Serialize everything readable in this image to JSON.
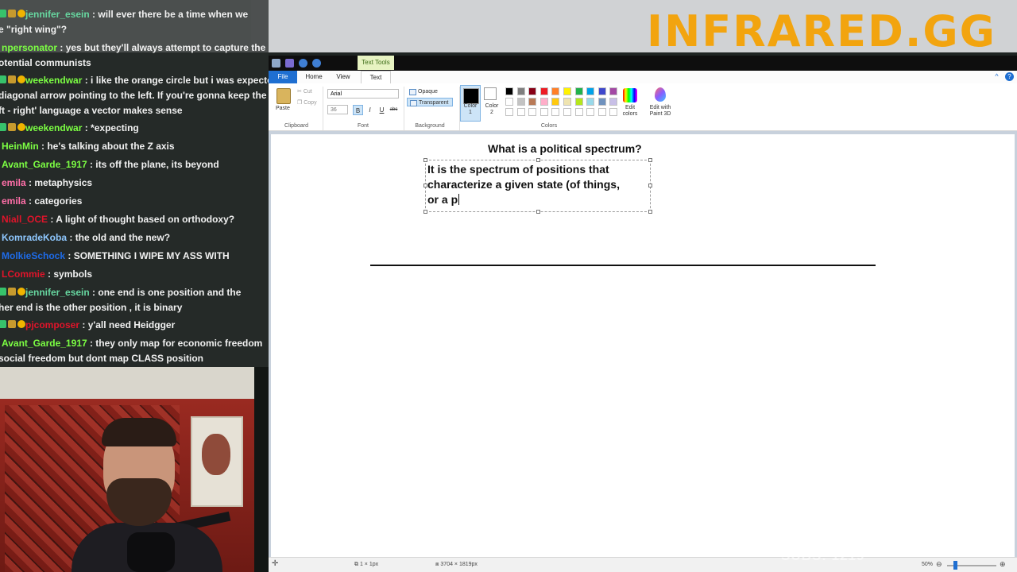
{
  "brand": {
    "logo": "INFRARED.GG"
  },
  "chat": {
    "messages": [
      {
        "user": "jennifer_esein",
        "text": ": will ever there be a time when we",
        "color": "#67d7a0",
        "badges": true
      },
      {
        "user": "",
        "text": "e \"right wing\"?",
        "color": "#f1f1f1",
        "badges": false
      },
      {
        "user": "npersonator",
        "text": ": yes but they'll always attempt to capture the",
        "color": "#7cff43",
        "badges": false
      },
      {
        "user": "",
        "text": "otential communists",
        "color": "#f1f1f1",
        "badges": false
      },
      {
        "user": "weekendwar",
        "text": ": i like the orange circle but i was expected",
        "color": "#7cff43",
        "badges": true
      },
      {
        "user": "",
        "text": "diagonal arrow pointing to the left. If you're gonna keep the",
        "color": "#f1f1f1",
        "badges": false
      },
      {
        "user": "",
        "text": "ft - right' language a vector makes sense",
        "color": "#f1f1f1",
        "badges": false
      },
      {
        "user": "weekendwar",
        "text": ": *expecting",
        "color": "#7cff43",
        "badges": true
      },
      {
        "user": "HeinMin",
        "text": ": he's talking about the Z axis",
        "color": "#7cff43",
        "badges": false
      },
      {
        "user": "Avant_Garde_1917",
        "text": ": its off the plane, its beyond",
        "color": "#7cff43",
        "badges": false
      },
      {
        "user": "emila",
        "text": ": metaphysics",
        "color": "#ff6fa8",
        "badges": false
      },
      {
        "user": "emila",
        "text": ": categories",
        "color": "#ff6fa8",
        "badges": false
      },
      {
        "user": "Niall_OCE",
        "text": ": A light of thought based on orthodoxy?",
        "color": "#e0142a",
        "badges": false
      },
      {
        "user": "KomradeKoba",
        "text": ": the old and the new?",
        "color": "#8fc8ff",
        "badges": false
      },
      {
        "user": "MolkieSchock",
        "text": ": SOMETHING I WIPE MY ASS WITH",
        "color": "#1e6be8",
        "badges": false
      },
      {
        "user": "LCommie",
        "text": ": symbols",
        "color": "#e0142a",
        "badges": false
      },
      {
        "user": "jennifer_esein",
        "text": ": one end is one position and the",
        "color": "#67d7a0",
        "badges": true
      },
      {
        "user": "",
        "text": "her end is the other position , it is binary",
        "color": "#f1f1f1",
        "badges": false
      },
      {
        "user": "pjcomposer",
        "text": ": y'all need Heidgger",
        "color": "#e0142a",
        "badges": true
      },
      {
        "user": "Avant_Garde_1917",
        "text": ": they only map for economic freedom",
        "color": "#7cff43",
        "badges": false
      },
      {
        "user": "",
        "text": "social freedom but dont map CLASS position",
        "color": "#f1f1f1",
        "badges": false
      }
    ]
  },
  "paint": {
    "context_tab": "Text Tools",
    "tabs": {
      "file": "File",
      "home": "Home",
      "view": "View",
      "text": "Text"
    },
    "clipboard": {
      "paste": "Paste",
      "cut": "Cut",
      "copy": "Copy",
      "label": "Clipboard"
    },
    "font": {
      "family": "Arial",
      "size": "36",
      "bold": "B",
      "italic": "I",
      "underline": "U",
      "strike": "abc",
      "label": "Font"
    },
    "background": {
      "opaque": "Opaque",
      "transparent": "Transparent",
      "label": "Background"
    },
    "colors": {
      "color1_label": "Color 1",
      "color1_value": "#000000",
      "color2_label": "Color 2",
      "color2_value": "#ffffff",
      "edit_colors": "Edit colors",
      "edit_paint3d": "Edit with Paint 3D",
      "label": "Colors",
      "palette_row1": [
        "#000000",
        "#7f7f7f",
        "#880015",
        "#ed1c24",
        "#ff7f27",
        "#fff200",
        "#22b14c",
        "#00a2e8",
        "#3f48cc",
        "#a349a4"
      ],
      "palette_row2": [
        "#ffffff",
        "#c3c3c3",
        "#b97a57",
        "#ffaec9",
        "#ffc90e",
        "#efe4b0",
        "#b5e61d",
        "#99d9ea",
        "#7092be",
        "#c8bfe7"
      ]
    },
    "canvas": {
      "title": "What is a political spectrum?",
      "text_lines": [
        "It is the spectrum of positions that",
        "characterize a given state (of things,",
        "or a p"
      ]
    },
    "status": {
      "selection": "1 × 1px",
      "size": "3704 × 1819px",
      "zoom": "50%"
    }
  },
  "overlay": {
    "subs": "SUBS: 1219"
  }
}
